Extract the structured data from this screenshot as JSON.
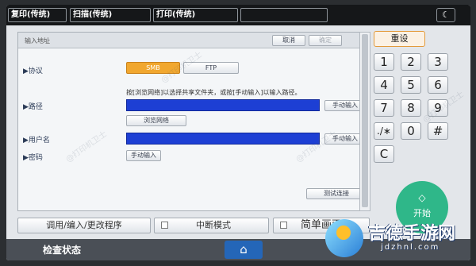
{
  "tabs": [
    "复印(传统)",
    "扫描(传统)",
    "打印(传统)",
    ""
  ],
  "topbar": {
    "moon_icon": "crescent-moon-icon"
  },
  "dialog": {
    "title": "输入地址",
    "cancel": "取消",
    "confirm": "确定",
    "protocol_label": "▶协议",
    "protocol_options": [
      "SMB",
      "FTP"
    ],
    "hint": "按[浏览网络]以选择共享文件夹，或按[手动输入]以输入路径。",
    "path_label": "▶路径",
    "manual_input": "手动输入",
    "browse_network": "浏览网络",
    "username_label": "▶用户名",
    "password_label": "▶密码",
    "test_connection": "测试连接"
  },
  "keypad": {
    "reset": "重设",
    "keys": [
      "1",
      "2",
      "3",
      "4",
      "5",
      "6",
      "7",
      "8",
      "9",
      "./∗",
      "0",
      "#",
      "C"
    ]
  },
  "start": {
    "label": "开始",
    "icon": "◇"
  },
  "bottom": {
    "program": "调用/编入/更改程序",
    "interrupt": "中断模式",
    "simple_screen": "简单画面"
  },
  "statusbar": {
    "check_status": "检查状态",
    "home_icon": "⌂"
  },
  "watermark": {
    "text": "@打印机卫士",
    "brand": "吉德手游网",
    "brand_url": "jdzhnl.com"
  },
  "colors": {
    "accent": "#1d3fd4",
    "start": "#2fb789",
    "home": "#2466b8",
    "selected": "#f1a72f"
  }
}
